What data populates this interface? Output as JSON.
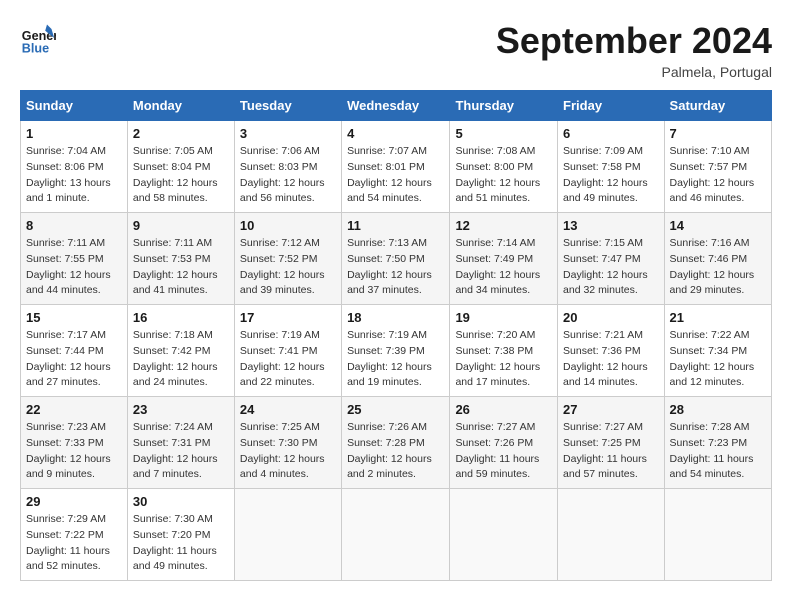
{
  "header": {
    "logo_general": "General",
    "logo_blue": "Blue",
    "month_title": "September 2024",
    "subtitle": "Palmela, Portugal"
  },
  "columns": [
    "Sunday",
    "Monday",
    "Tuesday",
    "Wednesday",
    "Thursday",
    "Friday",
    "Saturday"
  ],
  "weeks": [
    [
      {
        "day": "1",
        "rise": "Sunrise: 7:04 AM",
        "set": "Sunset: 8:06 PM",
        "daylight": "Daylight: 13 hours and 1 minute."
      },
      {
        "day": "2",
        "rise": "Sunrise: 7:05 AM",
        "set": "Sunset: 8:04 PM",
        "daylight": "Daylight: 12 hours and 58 minutes."
      },
      {
        "day": "3",
        "rise": "Sunrise: 7:06 AM",
        "set": "Sunset: 8:03 PM",
        "daylight": "Daylight: 12 hours and 56 minutes."
      },
      {
        "day": "4",
        "rise": "Sunrise: 7:07 AM",
        "set": "Sunset: 8:01 PM",
        "daylight": "Daylight: 12 hours and 54 minutes."
      },
      {
        "day": "5",
        "rise": "Sunrise: 7:08 AM",
        "set": "Sunset: 8:00 PM",
        "daylight": "Daylight: 12 hours and 51 minutes."
      },
      {
        "day": "6",
        "rise": "Sunrise: 7:09 AM",
        "set": "Sunset: 7:58 PM",
        "daylight": "Daylight: 12 hours and 49 minutes."
      },
      {
        "day": "7",
        "rise": "Sunrise: 7:10 AM",
        "set": "Sunset: 7:57 PM",
        "daylight": "Daylight: 12 hours and 46 minutes."
      }
    ],
    [
      {
        "day": "8",
        "rise": "Sunrise: 7:11 AM",
        "set": "Sunset: 7:55 PM",
        "daylight": "Daylight: 12 hours and 44 minutes."
      },
      {
        "day": "9",
        "rise": "Sunrise: 7:11 AM",
        "set": "Sunset: 7:53 PM",
        "daylight": "Daylight: 12 hours and 41 minutes."
      },
      {
        "day": "10",
        "rise": "Sunrise: 7:12 AM",
        "set": "Sunset: 7:52 PM",
        "daylight": "Daylight: 12 hours and 39 minutes."
      },
      {
        "day": "11",
        "rise": "Sunrise: 7:13 AM",
        "set": "Sunset: 7:50 PM",
        "daylight": "Daylight: 12 hours and 37 minutes."
      },
      {
        "day": "12",
        "rise": "Sunrise: 7:14 AM",
        "set": "Sunset: 7:49 PM",
        "daylight": "Daylight: 12 hours and 34 minutes."
      },
      {
        "day": "13",
        "rise": "Sunrise: 7:15 AM",
        "set": "Sunset: 7:47 PM",
        "daylight": "Daylight: 12 hours and 32 minutes."
      },
      {
        "day": "14",
        "rise": "Sunrise: 7:16 AM",
        "set": "Sunset: 7:46 PM",
        "daylight": "Daylight: 12 hours and 29 minutes."
      }
    ],
    [
      {
        "day": "15",
        "rise": "Sunrise: 7:17 AM",
        "set": "Sunset: 7:44 PM",
        "daylight": "Daylight: 12 hours and 27 minutes."
      },
      {
        "day": "16",
        "rise": "Sunrise: 7:18 AM",
        "set": "Sunset: 7:42 PM",
        "daylight": "Daylight: 12 hours and 24 minutes."
      },
      {
        "day": "17",
        "rise": "Sunrise: 7:19 AM",
        "set": "Sunset: 7:41 PM",
        "daylight": "Daylight: 12 hours and 22 minutes."
      },
      {
        "day": "18",
        "rise": "Sunrise: 7:19 AM",
        "set": "Sunset: 7:39 PM",
        "daylight": "Daylight: 12 hours and 19 minutes."
      },
      {
        "day": "19",
        "rise": "Sunrise: 7:20 AM",
        "set": "Sunset: 7:38 PM",
        "daylight": "Daylight: 12 hours and 17 minutes."
      },
      {
        "day": "20",
        "rise": "Sunrise: 7:21 AM",
        "set": "Sunset: 7:36 PM",
        "daylight": "Daylight: 12 hours and 14 minutes."
      },
      {
        "day": "21",
        "rise": "Sunrise: 7:22 AM",
        "set": "Sunset: 7:34 PM",
        "daylight": "Daylight: 12 hours and 12 minutes."
      }
    ],
    [
      {
        "day": "22",
        "rise": "Sunrise: 7:23 AM",
        "set": "Sunset: 7:33 PM",
        "daylight": "Daylight: 12 hours and 9 minutes."
      },
      {
        "day": "23",
        "rise": "Sunrise: 7:24 AM",
        "set": "Sunset: 7:31 PM",
        "daylight": "Daylight: 12 hours and 7 minutes."
      },
      {
        "day": "24",
        "rise": "Sunrise: 7:25 AM",
        "set": "Sunset: 7:30 PM",
        "daylight": "Daylight: 12 hours and 4 minutes."
      },
      {
        "day": "25",
        "rise": "Sunrise: 7:26 AM",
        "set": "Sunset: 7:28 PM",
        "daylight": "Daylight: 12 hours and 2 minutes."
      },
      {
        "day": "26",
        "rise": "Sunrise: 7:27 AM",
        "set": "Sunset: 7:26 PM",
        "daylight": "Daylight: 11 hours and 59 minutes."
      },
      {
        "day": "27",
        "rise": "Sunrise: 7:27 AM",
        "set": "Sunset: 7:25 PM",
        "daylight": "Daylight: 11 hours and 57 minutes."
      },
      {
        "day": "28",
        "rise": "Sunrise: 7:28 AM",
        "set": "Sunset: 7:23 PM",
        "daylight": "Daylight: 11 hours and 54 minutes."
      }
    ],
    [
      {
        "day": "29",
        "rise": "Sunrise: 7:29 AM",
        "set": "Sunset: 7:22 PM",
        "daylight": "Daylight: 11 hours and 52 minutes."
      },
      {
        "day": "30",
        "rise": "Sunrise: 7:30 AM",
        "set": "Sunset: 7:20 PM",
        "daylight": "Daylight: 11 hours and 49 minutes."
      },
      null,
      null,
      null,
      null,
      null
    ]
  ]
}
